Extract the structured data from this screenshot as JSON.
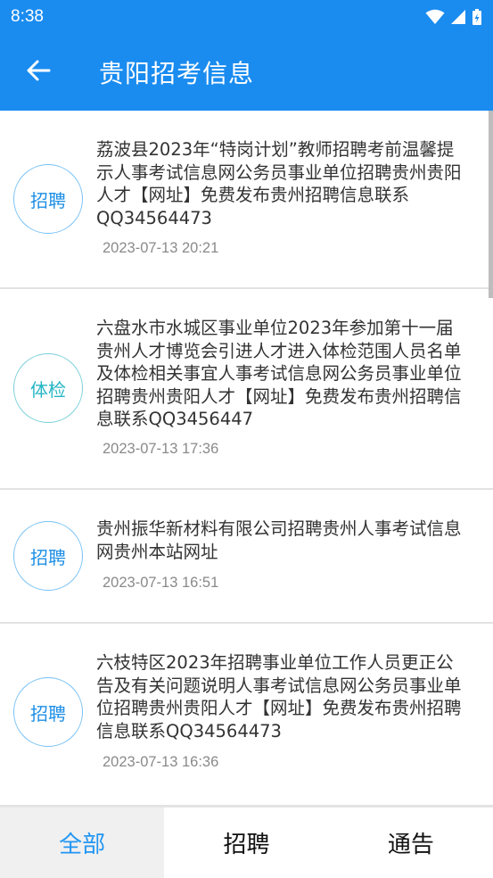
{
  "status_bar": {
    "time": "8:38"
  },
  "header": {
    "title": "贵阳招考信息"
  },
  "items": [
    {
      "badge": "招聘",
      "title": "荔波县2023年“特岗计划”教师招聘考前温馨提示人事考试信息网公务员事业单位招聘贵州贵阳人才【网址】免费发布贵州招聘信息联系QQ34564473",
      "date": "2023-07-13 20:21"
    },
    {
      "badge": "体检",
      "title": "六盘水市水城区事业单位2023年参加第十一届贵州人才博览会引进人才进入体检范围人员名单及体检相关事宜人事考试信息网公务员事业单位招聘贵州贵阳人才【网址】免费发布贵州招聘信息联系QQ3456447",
      "date": "2023-07-13 17:36"
    },
    {
      "badge": "招聘",
      "title": "贵州振华新材料有限公司招聘贵州人事考试信息网贵州本站网址",
      "date": "2023-07-13 16:51"
    },
    {
      "badge": "招聘",
      "title": "六枝特区2023年招聘事业单位工作人员更正公告及有关问题说明人事考试信息网公务员事业单位招聘贵州贵阳人才【网址】免费发布贵州招聘信息联系QQ34564473",
      "date": "2023-07-13 16:36"
    }
  ],
  "tabs": [
    {
      "label": "全部"
    },
    {
      "label": "招聘"
    },
    {
      "label": "通告"
    }
  ]
}
